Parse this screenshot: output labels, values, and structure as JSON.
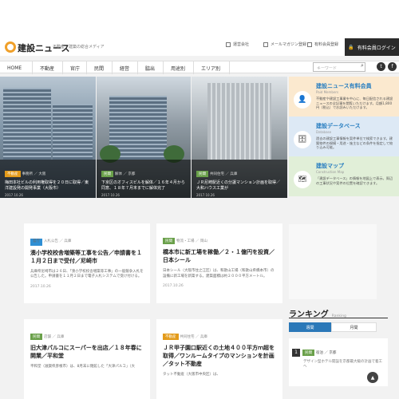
{
  "header": {
    "logo": "建設ニュース",
    "tagline": "不動産・建築の総合メディア",
    "links": [
      "運営会社",
      "メールマガジン登録",
      "有料会員登録"
    ],
    "login": "有料会員ログイン"
  },
  "nav": {
    "items": [
      "HOME",
      "不動産",
      "官庁",
      "民間",
      "経営",
      "脇出",
      "用途別",
      "エリア別"
    ],
    "search_placeholder": "キーワード"
  },
  "hero": [
    {
      "badge": "不動産",
      "cat": "事務所 ／ 大阪",
      "title": "梅田本社ビルの利用権取得を２０日に取得／東洋建設発の開発事業（大阪市）",
      "date": "2017.10.26"
    },
    {
      "badge": "民間",
      "cat": "解体 ／ 京都",
      "title": "下京区のオフィスビルを解体／１６年４月から同意、１８年７月末までに解体完了",
      "date": "2017.10.26"
    },
    {
      "badge": "民間",
      "cat": "共同住宅 ／ 兵庫",
      "title": "ＪＲ尼崎駅近くの分譲マンション計画を取得／大和ハウス工業が",
      "date": "2017.10.26"
    }
  ],
  "side": [
    {
      "title": "建設ニュース有料会員",
      "en": "Paid Members",
      "text": "不動産や建設工事業を中心に、毎日配信される建設ニュースの全記事を閲覧いただけます。月額1,800円（税込）でお読みいただけます。"
    },
    {
      "title": "建設データベース",
      "en": "Database",
      "text": "過去の建設工事情報を案件単位で検索できます。建築物件の規模・用途・施主などの条件を指定して絞り込み可能。"
    },
    {
      "title": "建設マップ",
      "en": "Construction Map",
      "text": "「建設データベース」の情報を地図上で表示。周辺の工事状況や案件の位置を確認できます。"
    }
  ],
  "cards": [
    {
      "badge": "官庁",
      "cat": "入札公告 ／ 兵庫",
      "title": "湊小学校校舎増築等工事を公告／申請書を１１月２日まで受付／尼崎市",
      "body": "兵庫県尼崎市は２６日、「湊小学校校舎増築等工事」の一般競争入札を公告した。申請書を１１月２日まで電子入札システムで受け付ける。",
      "date": "2017.10.26"
    },
    {
      "badge": "民間",
      "cat": "物流・工場 ／ 岡山",
      "title": "橋本市に新工場を稼働／２・１億円を投資／日本シール",
      "body": "日本シール（大阪市住之江区）は、和歌山工場（和歌山県橋本市）の設備に新工場を新築する。建築面積は約２０００平方メートル。",
      "date": "2017.10.26"
    },
    {
      "badge": "民間",
      "cat": "店舗 ／ 兵庫",
      "title": "旧大津パルコにスーパーを出店／１８年春に開業／平和堂",
      "body": "平和堂（滋賀県彦根市）は、8月末に閉館した「大津パルコ」（大",
      "date": ""
    },
    {
      "badge": "不動産",
      "cat": "共同住宅 ／ 兵庫",
      "title": "ＪＲ甲子園口駅近くの土地４００平方ｍ超を取得／ワンルームタイプのマンションを計画／タット不動産",
      "body": "タット不動産（大阪市中央区）は、",
      "date": ""
    }
  ],
  "ranking": {
    "title": "ランキング",
    "en": "Ranking",
    "tabs": [
      "週間",
      "月間"
    ],
    "item": {
      "num": "1",
      "cat": "宿泊 ／ 京都",
      "text": "デザイン型ホテル開設を京都最大級の計画で着工へ"
    }
  },
  "colors": {
    "accent": "#2b78b8",
    "badge_green": "#6aa04a",
    "badge_orange": "#e39b1a",
    "login_bg": "#2b2b2b"
  }
}
